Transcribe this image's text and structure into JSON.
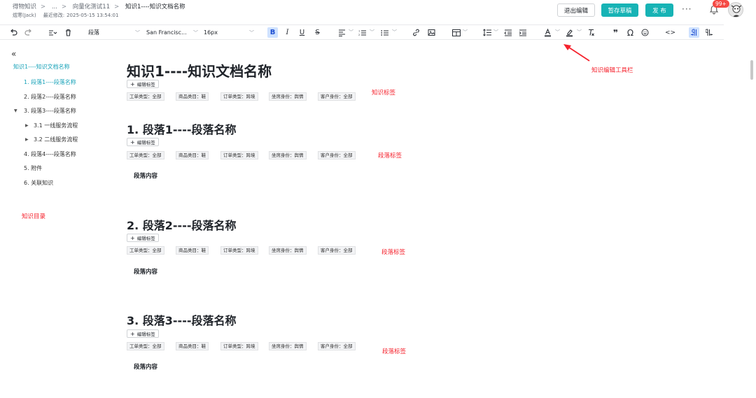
{
  "breadcrumb": {
    "items": [
      "得物知识",
      "...",
      "向量化测试11"
    ],
    "current": "知识1----知识文档名称"
  },
  "meta": {
    "author": "煜寒(Jack)",
    "last_modified_label": "最近修改:",
    "last_modified": "2025-05-15 13:54:01"
  },
  "header_buttons": {
    "exit_edit": "退出编辑",
    "save_draft": "暂存草稿",
    "publish": "发 布",
    "more": "···"
  },
  "notifications": {
    "badge": "99+"
  },
  "toolbar": {
    "undo_icon": "undo-icon",
    "redo_icon": "redo-icon",
    "paragraph_select": "段落",
    "font_select": "San Francisc...",
    "size_select": "16px",
    "bold_label": "B",
    "italic_label": "I",
    "underline_label": "U",
    "strike_label": "S",
    "omega_label": "Ω",
    "quote_label": "❞",
    "code_label": "<>"
  },
  "toc": {
    "collapse_icon": "«",
    "title": "知识1----知识文档名称",
    "items": [
      {
        "label": "1. 段落1----段落名称",
        "active": true
      },
      {
        "label": "2. 段落2----段落名称"
      },
      {
        "label": "3. 段落3----段落名称",
        "expanded": true
      },
      {
        "label": "3.1 一线服务流程"
      },
      {
        "label": "3.2 二线服务流程"
      },
      {
        "label": "4. 段落4----段落名称"
      },
      {
        "label": "5. 附件"
      },
      {
        "label": "6. 关联知识"
      }
    ]
  },
  "document": {
    "title": "知识1----知识文档名称",
    "edit_tag_label": "编辑标签",
    "tags": [
      "工单类型：全部",
      "商品类目：鞋",
      "订单类型：跨境",
      "坐席身份：舆情",
      "客户身份：全部"
    ],
    "sections": [
      {
        "title": "1. 段落1----段落名称",
        "content": "段落内容"
      },
      {
        "title": "2. 段落2----段落名称",
        "content": "段落内容"
      },
      {
        "title": "3. 段落3----段落名称",
        "content": "段落内容"
      }
    ]
  },
  "annotations": {
    "toolbar": "知识编辑工具栏",
    "doc_tags": "知识标签",
    "section_tags": "段落标签",
    "toc": "知识目录"
  },
  "colors": {
    "accent": "#17b3b5",
    "link": "#17a2b8",
    "annotation": "#f5222d",
    "badge": "#f54a45"
  }
}
